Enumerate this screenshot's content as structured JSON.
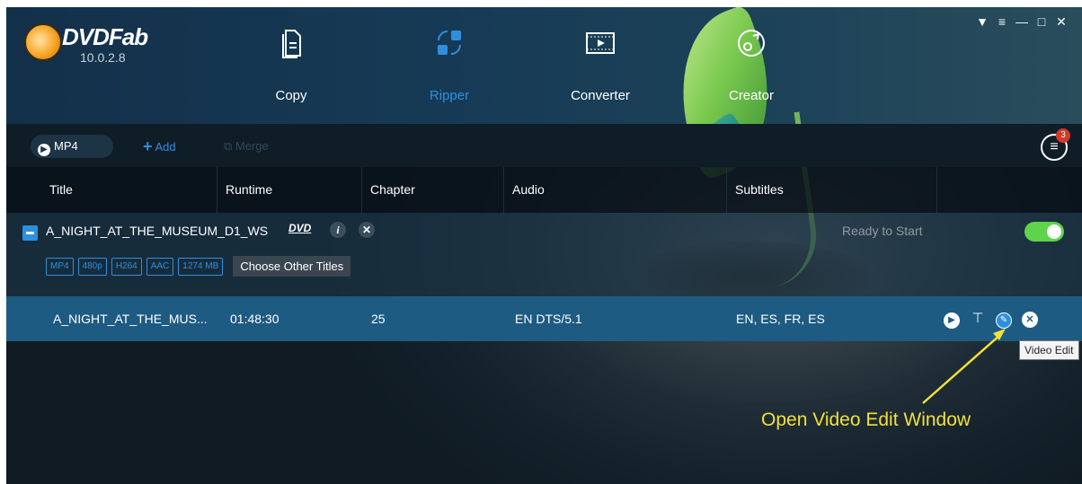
{
  "app": {
    "name": "DVDFab",
    "version": "10.0.2.8"
  },
  "modules": [
    {
      "label": "Copy",
      "icon": "document-icon"
    },
    {
      "label": "Ripper",
      "icon": "ripper-icon",
      "active": true
    },
    {
      "label": "Converter",
      "icon": "film-icon"
    },
    {
      "label": "Creator",
      "icon": "disc-icon"
    }
  ],
  "window_controls": [
    "pin-icon",
    "dropdown-icon",
    "minimize-icon",
    "maximize-icon",
    "close-icon"
  ],
  "toolbar": {
    "profile_label": "MP4",
    "add_label": "Add",
    "merge_label": "Merge",
    "task_badge_count": "3"
  },
  "columns": {
    "title": "Title",
    "runtime": "Runtime",
    "chapter": "Chapter",
    "audio": "Audio",
    "subtitles": "Subtitles"
  },
  "source": {
    "title": "A_NIGHT_AT_THE_MUSEUM_D1_WS",
    "disc_type": "DVD",
    "status": "Ready to Start",
    "enabled": true,
    "tags": [
      "MP4",
      "480p",
      "H264",
      "AAC",
      "1274 MB"
    ],
    "choose_label": "Choose Other Titles"
  },
  "track": {
    "title": "A_NIGHT_AT_THE_MUS...",
    "runtime": "01:48:30",
    "chapter": "25",
    "audio": "EN DTS/5.1",
    "subtitles": "EN, ES, FR, ES"
  },
  "tooltip": "Video Edit",
  "annotation": "Open Video Edit Window",
  "colors": {
    "accent": "#2e8fdf",
    "track_row": "#1e5b82",
    "toggle_on": "#5fd44a",
    "annotation": "#f2e03a",
    "badge": "#d43a2a"
  }
}
